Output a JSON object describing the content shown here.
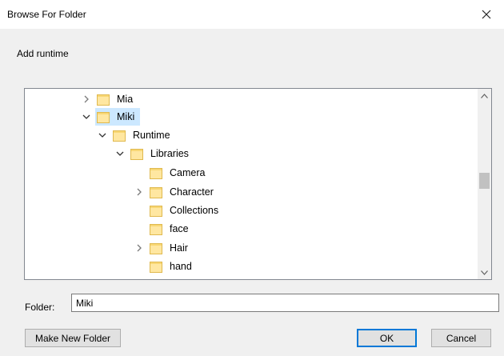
{
  "window": {
    "title": "Browse For Folder",
    "close_glyph": "✕"
  },
  "description": "Add runtime",
  "tree": {
    "nodes": [
      {
        "label": "Mia",
        "expander": "collapsed",
        "selected": false
      },
      {
        "label": "Miki",
        "expander": "expanded",
        "selected": true
      },
      {
        "label": "Runtime",
        "expander": "expanded",
        "selected": false
      },
      {
        "label": "Libraries",
        "expander": "expanded",
        "selected": false
      },
      {
        "label": "Camera",
        "expander": "none",
        "selected": false
      },
      {
        "label": "Character",
        "expander": "collapsed",
        "selected": false
      },
      {
        "label": "Collections",
        "expander": "none",
        "selected": false
      },
      {
        "label": "face",
        "expander": "none",
        "selected": false
      },
      {
        "label": "Hair",
        "expander": "collapsed",
        "selected": false
      },
      {
        "label": "hand",
        "expander": "none",
        "selected": false
      }
    ],
    "scroll_up_glyph": "▲",
    "scroll_down_glyph": "▼"
  },
  "folder_field": {
    "label": "Folder:",
    "value": "Miki"
  },
  "buttons": {
    "make_new_folder": "Make New Folder",
    "ok": "OK",
    "cancel": "Cancel"
  },
  "colors": {
    "selection": "#cce8ff",
    "folder_yellow": "#f8d775",
    "ok_border": "#0078d7"
  },
  "icons": {
    "close": "close-icon",
    "folder": "folder-icon",
    "chevron_right": "chevron-right-icon",
    "chevron_down": "chevron-down-icon"
  }
}
